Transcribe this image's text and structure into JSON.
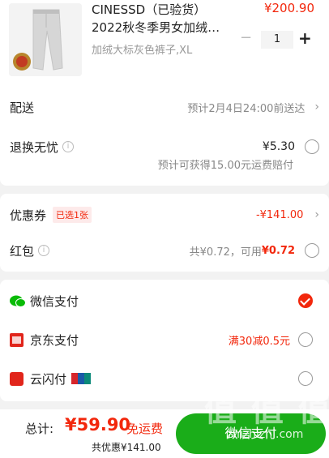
{
  "product": {
    "title_line1": "CINESSD（已验货）",
    "title_line2": "2022秋冬季男女加绒…",
    "spec": "加绒大标灰色裤子,XL",
    "price": "¥200.90",
    "quantity": "1",
    "minus": "−",
    "plus": "+"
  },
  "delivery": {
    "label": "配送",
    "value": "预计2月4日24:00前送达"
  },
  "return_insurance": {
    "label": "退换无忧",
    "price": "¥5.30",
    "note": "预计可获得15.00元运费赔付"
  },
  "coupon": {
    "label": "优惠券",
    "badge": "已选1张",
    "value": "-¥141.00"
  },
  "red_packet": {
    "label": "红包",
    "prefix": "共¥0.72，可用",
    "available": "¥0.72"
  },
  "payments": [
    {
      "label": "微信支付",
      "promo": "",
      "selected": true
    },
    {
      "label": "京东支付",
      "promo": "满30减0.5元",
      "selected": false
    },
    {
      "label": "云闪付",
      "promo": "",
      "selected": false
    }
  ],
  "footer": {
    "total_label": "总计:",
    "total_value": "¥59.90",
    "shipping": "免运费",
    "discount": "共优惠¥141.00",
    "pay_button": "微信支付"
  },
  "watermark": {
    "text": "值 值 值",
    "url": "zhizhizhi.com"
  },
  "colors": {
    "accent": "#f2270c",
    "wechat_green": "#09bb07",
    "pay_button": "#1aad19"
  }
}
